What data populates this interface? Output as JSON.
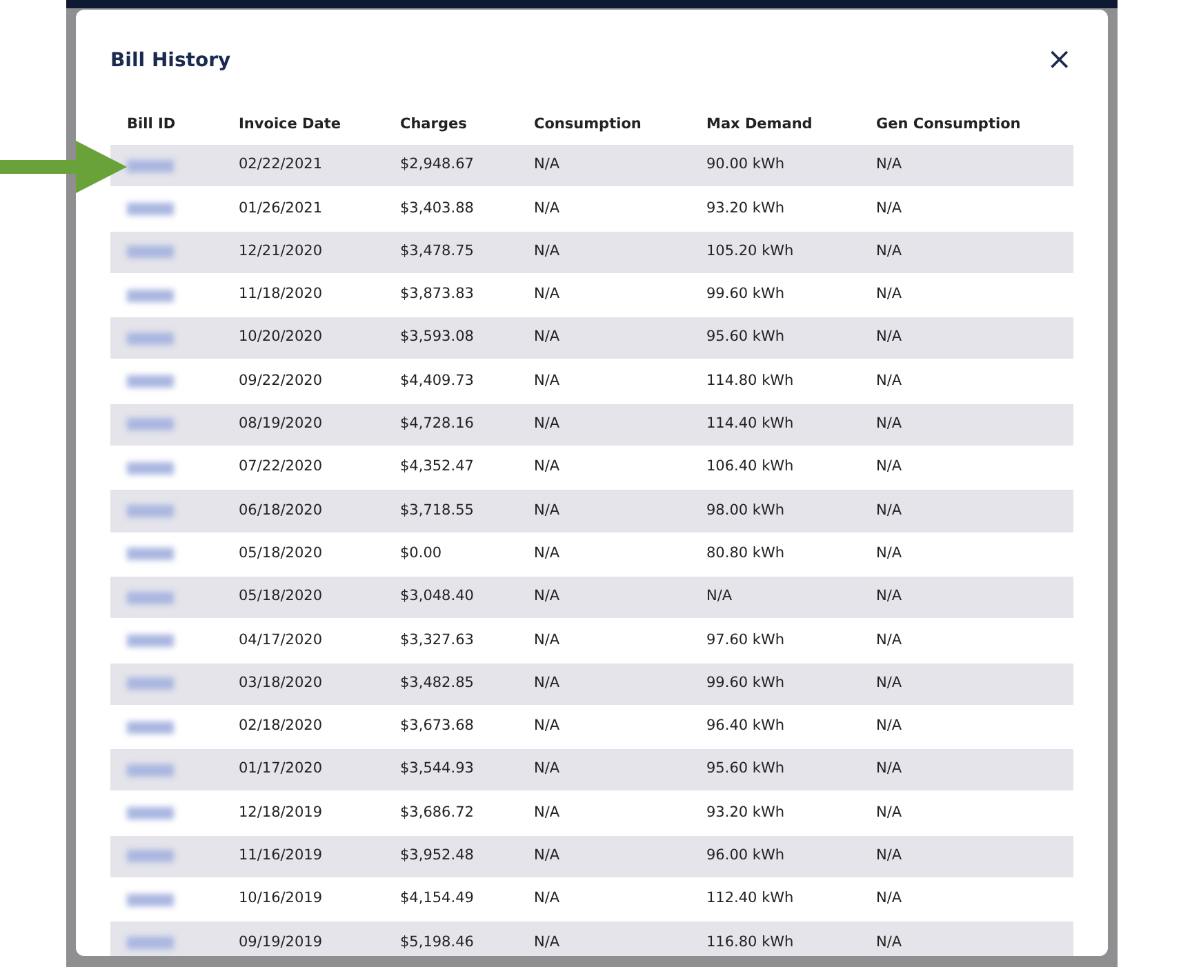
{
  "modal": {
    "title": "Bill History",
    "close": "×"
  },
  "table": {
    "columns": [
      "Bill ID",
      "Invoice Date",
      "Charges",
      "Consumption",
      "Max Demand",
      "Gen Consumption"
    ],
    "rows": [
      {
        "selected": true,
        "cells": [
          "",
          "02/22/2021",
          "$2,948.67",
          "N/A",
          "90.00 kWh",
          "N/A"
        ]
      },
      {
        "selected": false,
        "cells": [
          "",
          "01/26/2021",
          "$3,403.88",
          "N/A",
          "93.20 kWh",
          "N/A"
        ]
      },
      {
        "selected": false,
        "cells": [
          "",
          "12/21/2020",
          "$3,478.75",
          "N/A",
          "105.20 kWh",
          "N/A"
        ]
      },
      {
        "selected": false,
        "cells": [
          "",
          "11/18/2020",
          "$3,873.83",
          "N/A",
          "99.60 kWh",
          "N/A"
        ]
      },
      {
        "selected": false,
        "cells": [
          "",
          "10/20/2020",
          "$3,593.08",
          "N/A",
          "95.60 kWh",
          "N/A"
        ]
      },
      {
        "selected": false,
        "cells": [
          "",
          "09/22/2020",
          "$4,409.73",
          "N/A",
          "114.80 kWh",
          "N/A"
        ]
      },
      {
        "selected": false,
        "cells": [
          "",
          "08/19/2020",
          "$4,728.16",
          "N/A",
          "114.40 kWh",
          "N/A"
        ]
      },
      {
        "selected": false,
        "cells": [
          "",
          "07/22/2020",
          "$4,352.47",
          "N/A",
          "106.40 kWh",
          "N/A"
        ]
      },
      {
        "selected": false,
        "cells": [
          "",
          "06/18/2020",
          "$3,718.55",
          "N/A",
          "98.00 kWh",
          "N/A"
        ]
      },
      {
        "selected": false,
        "cells": [
          "",
          "05/18/2020",
          "$0.00",
          "N/A",
          "80.80 kWh",
          "N/A"
        ]
      },
      {
        "selected": false,
        "cells": [
          "",
          "05/18/2020",
          "$3,048.40",
          "N/A",
          "N/A",
          "N/A"
        ]
      },
      {
        "selected": false,
        "cells": [
          "",
          "04/17/2020",
          "$3,327.63",
          "N/A",
          "97.60 kWh",
          "N/A"
        ]
      },
      {
        "selected": false,
        "cells": [
          "",
          "03/18/2020",
          "$3,482.85",
          "N/A",
          "99.60 kWh",
          "N/A"
        ]
      },
      {
        "selected": false,
        "cells": [
          "",
          "02/18/2020",
          "$3,673.68",
          "N/A",
          "96.40 kWh",
          "N/A"
        ]
      },
      {
        "selected": false,
        "cells": [
          "",
          "01/17/2020",
          "$3,544.93",
          "N/A",
          "95.60 kWh",
          "N/A"
        ]
      },
      {
        "selected": false,
        "cells": [
          "",
          "12/18/2019",
          "$3,686.72",
          "N/A",
          "93.20 kWh",
          "N/A"
        ]
      },
      {
        "selected": false,
        "cells": [
          "",
          "11/16/2019",
          "$3,952.48",
          "N/A",
          "96.00 kWh",
          "N/A"
        ]
      },
      {
        "selected": false,
        "cells": [
          "",
          "10/16/2019",
          "$4,154.49",
          "N/A",
          "112.40 kWh",
          "N/A"
        ]
      },
      {
        "selected": false,
        "cells": [
          "",
          "09/19/2019",
          "$5,198.46",
          "N/A",
          "116.80 kWh",
          "N/A"
        ]
      }
    ]
  }
}
